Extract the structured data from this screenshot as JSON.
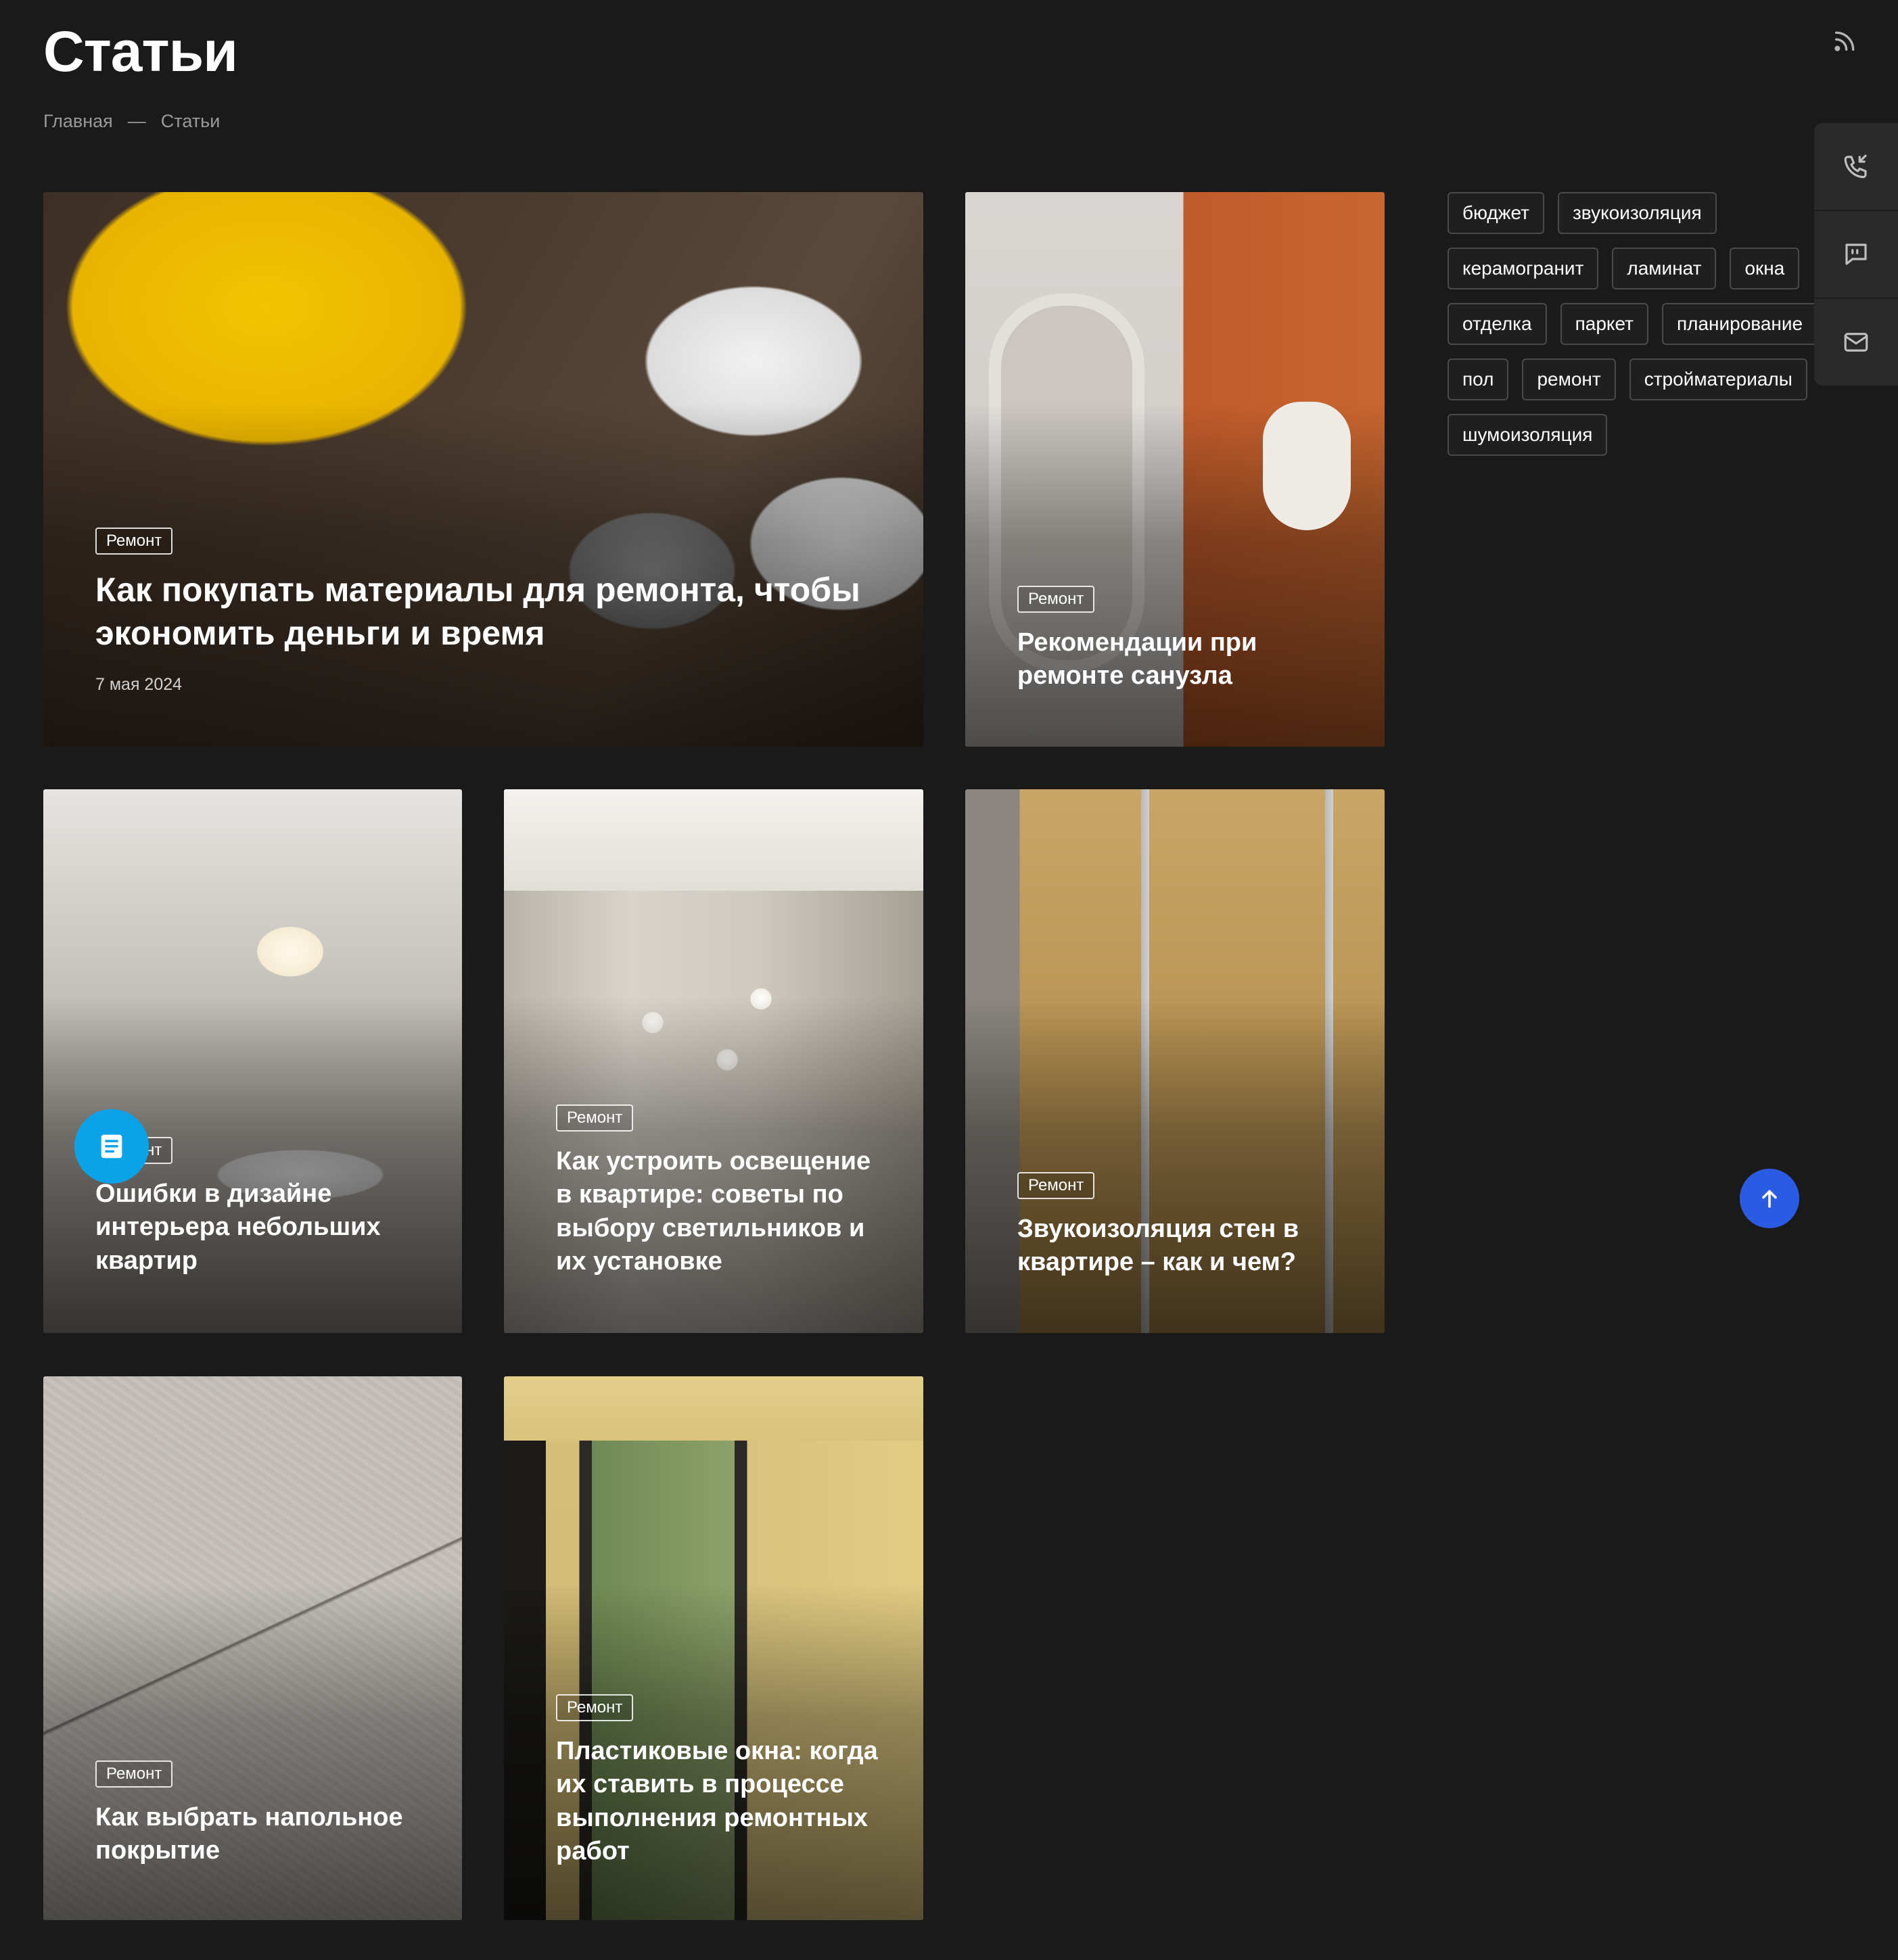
{
  "page": {
    "title": "Статьи",
    "breadcrumb": {
      "home": "Главная",
      "separator": "—",
      "current": "Статьи"
    }
  },
  "articles": [
    {
      "category": "Ремонт",
      "title": "Как покупать материалы для ремонта, чтобы экономить деньги и время",
      "date": "7 мая 2024"
    },
    {
      "category": "Ремонт",
      "title": "Рекомендации при ремонте санузла"
    },
    {
      "category": "Ремонт",
      "title": "Ошибки в дизайне интерьера небольших квартир"
    },
    {
      "category": "Ремонт",
      "title": "Как устроить освещение в квартире: советы по выбору светильников и их установке"
    },
    {
      "category": "Ремонт",
      "title": "Звукоизоляция стен в квартире – как и чем?"
    },
    {
      "category": "Ремонт",
      "title": "Как выбрать напольное покрытие"
    },
    {
      "category": "Ремонт",
      "title": "Пластиковые окна: когда их ставить в процессе выполнения ремонтных работ"
    }
  ],
  "tags": [
    "бюджет",
    "звукоизоляция",
    "керамогранит",
    "ламинат",
    "окна",
    "отделка",
    "паркет",
    "планирование",
    "пол",
    "ремонт",
    "стройматериалы",
    "шумоизоляция"
  ],
  "icons": {
    "rss": "rss-icon",
    "side_panel": [
      "phone-callback-icon",
      "chat-quote-icon",
      "mail-icon"
    ],
    "scroll_top": "arrow-up-icon",
    "document_fab": "document-icon"
  },
  "colors": {
    "background": "#1a1a1b",
    "scroll_top": "#2c5be3",
    "document_fab": "#0aa3e8"
  }
}
